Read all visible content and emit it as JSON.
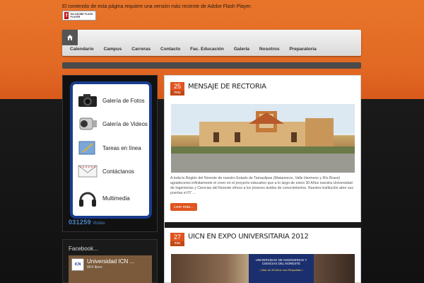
{
  "flash": {
    "message": "El contenido de esta página requiere una versión más reciente de Adobe Flash Player.",
    "badge_text": "Get ADOBE FLASH PLAYER"
  },
  "nav": {
    "items": [
      "Calendario",
      "Campus",
      "Carreras",
      "Contacto",
      "Fac. Educación",
      "Galería",
      "Nosotros",
      "Preparatoria"
    ]
  },
  "sidebar": {
    "menu": [
      {
        "label": "Galería de Fotos",
        "icon": "camera-icon"
      },
      {
        "label": "Galería de Videos",
        "icon": "video-camera-icon"
      },
      {
        "label": "Tareas en línea",
        "icon": "notebook-icon"
      },
      {
        "label": "Contáctanos",
        "icon": "envelope-icon"
      },
      {
        "label": "Multimedia",
        "icon": "headphones-icon"
      }
    ],
    "visits_count": "031259",
    "visits_label": "Visitas"
  },
  "facebook": {
    "title": "Facebook...",
    "page_name": "Universidad ICN ...",
    "likes": "864 likes",
    "logo_text": "ICN"
  },
  "posts": [
    {
      "day": "25",
      "month": "may",
      "title": "MENSAJE DE RECTORIA",
      "excerpt": "A toda la Región del Noreste de nuestro Estado de Tamaulipas (Matamoros, Valle Hermoso y Río Bravo) agradeceres infinitamente el creer en el proyecto educativo que a lo largo de estos 30 Años nuestra Universidad de Ingenierías y Ciencias del Noreste ofrece a los jóvenes ávidos de conocimientos. Nuestra institución abre sus puertas el 07 ...",
      "more_label": "Leer más..."
    },
    {
      "day": "27",
      "month": "mar",
      "title": "UICN EN EXPO UNIVERSITARIA 2012",
      "banner_line1": "UNIVERSIDAD DE INGENIERIAS Y CIENCIAS DEL NORESTE",
      "banner_line2": "¡ Más de 28 Años nos Respaldan !"
    }
  ],
  "colors": {
    "accent": "#e0541e",
    "frame_blue": "#1a3d8c",
    "visits_blue": "#4a87c6"
  }
}
